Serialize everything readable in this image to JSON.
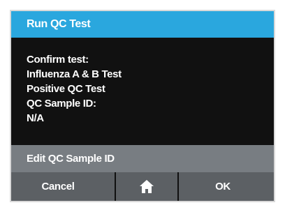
{
  "dialog": {
    "title": "Run QC Test",
    "message_lines": [
      "Confirm test:",
      "Influenza A & B Test",
      "Positive QC Test",
      "QC Sample ID:",
      "N/A"
    ],
    "edit_label": "Edit QC Sample ID"
  },
  "buttons": {
    "cancel_label": "Cancel",
    "home_icon": "home-icon",
    "ok_label": "OK"
  },
  "colors": {
    "title_bar": "#2aa7de",
    "background": "#111111",
    "edit_row": "#787d82",
    "buttons": "#5c6064",
    "text": "#ffffff"
  }
}
